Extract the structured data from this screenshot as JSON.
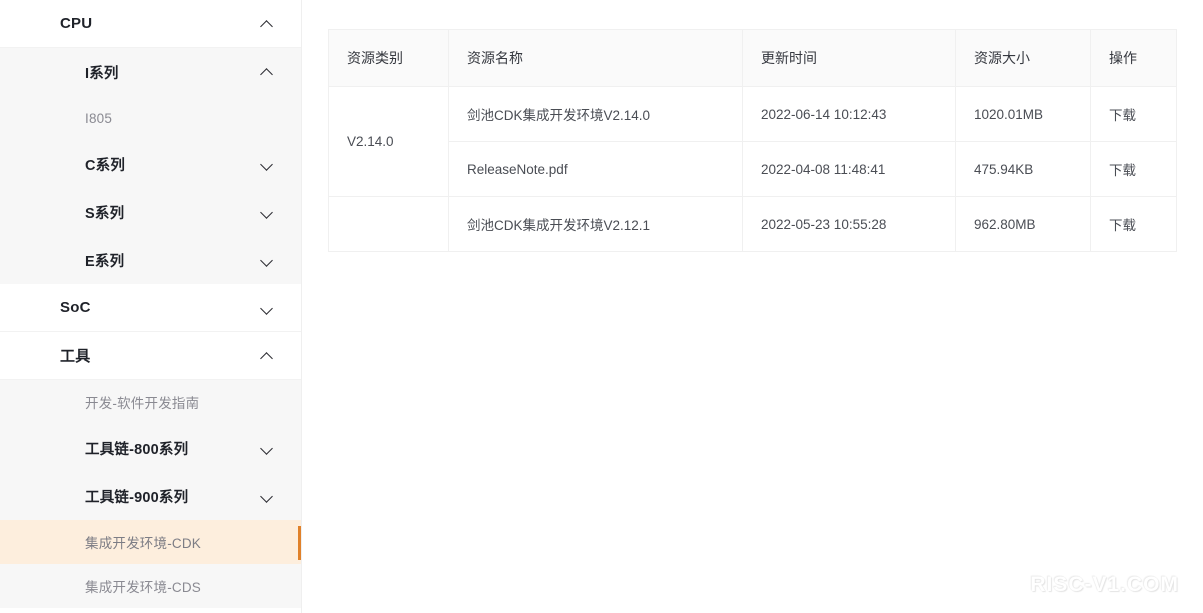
{
  "sidebar": {
    "groups": [
      {
        "label": "CPU",
        "icon": "chevron-up-icon",
        "expanded": true,
        "children": [
          {
            "label": "I系列",
            "icon": "chevron-up-icon",
            "expanded": true,
            "children": [
              {
                "label": "I805",
                "active": false
              }
            ]
          },
          {
            "label": "C系列",
            "icon": "chevron-down-icon",
            "expanded": false
          },
          {
            "label": "S系列",
            "icon": "chevron-down-icon",
            "expanded": false
          },
          {
            "label": "E系列",
            "icon": "chevron-down-icon",
            "expanded": false
          }
        ]
      },
      {
        "label": "SoC",
        "icon": "chevron-down-icon",
        "expanded": false,
        "children": []
      },
      {
        "label": "工具",
        "icon": "chevron-up-icon",
        "expanded": true,
        "children": [
          {
            "label": "开发-软件开发指南",
            "active": false
          },
          {
            "label": "工具链-800系列",
            "icon": "chevron-down-icon",
            "expanded": false
          },
          {
            "label": "工具链-900系列",
            "icon": "chevron-down-icon",
            "expanded": false
          },
          {
            "label": "集成开发环境-CDK",
            "active": true
          },
          {
            "label": "集成开发环境-CDS",
            "active": false
          }
        ]
      }
    ]
  },
  "table": {
    "headers": [
      "资源类别",
      "资源名称",
      "更新时间",
      "资源大小",
      "操作"
    ],
    "groups": [
      {
        "category": "V2.14.0",
        "rows": [
          {
            "name": "剑池CDK集成开发环境V2.14.0",
            "updated": "2022-06-14 10:12:43",
            "size": "1020.01MB",
            "action": "下载"
          },
          {
            "name": "ReleaseNote.pdf",
            "updated": "2022-04-08 11:48:41",
            "size": "475.94KB",
            "action": "下载"
          }
        ]
      },
      {
        "category": "",
        "rows": [
          {
            "name": "剑池CDK集成开发环境V2.12.1",
            "updated": "2022-05-23 10:55:28",
            "size": "962.80MB",
            "action": "下载"
          }
        ]
      }
    ]
  },
  "watermark": {
    "text": "RISC-V1.COM"
  },
  "colors": {
    "accent": "#e0812a",
    "active_row_bg": "#fdeedd",
    "submenu_bg": "#f7f7f7",
    "table_header_bg": "#fafafa",
    "border": "#f0f0f0"
  }
}
